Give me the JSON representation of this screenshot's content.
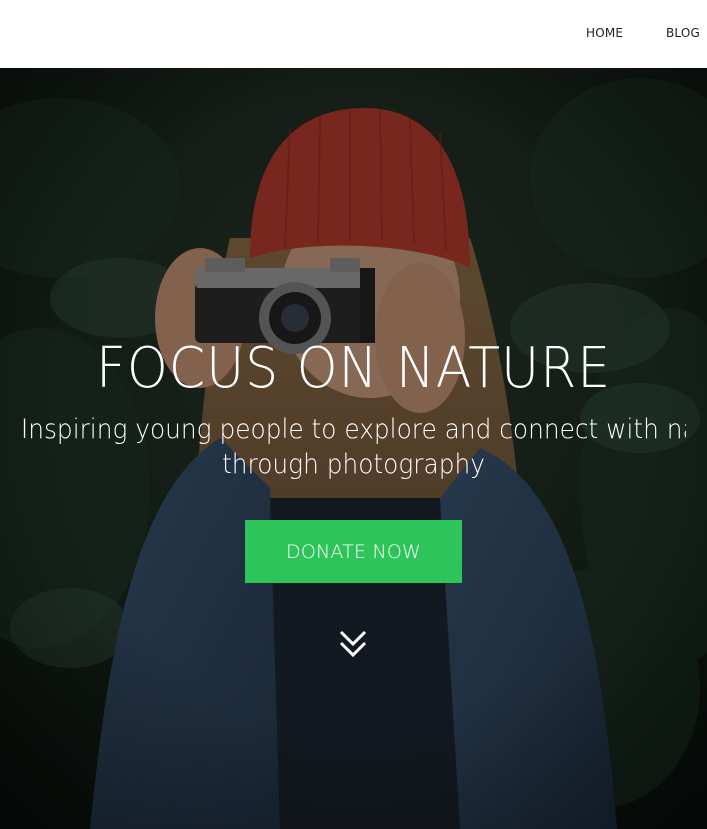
{
  "header": {
    "nav": {
      "home_label": "HOME",
      "blog_label": "BLOG"
    }
  },
  "hero": {
    "title": "FOCUS ON NATURE",
    "subtitle_line1": "Inspiring young people to explore and connect with nature",
    "subtitle_line2": "through photography",
    "donate_label": "DONATE NOW",
    "scroll_icon": "double-chevron-down-icon",
    "background_image": "woman-with-camera-photo"
  },
  "colors": {
    "accent": "#2dc55a",
    "header_bg": "#ffffff",
    "nav_text": "#1f1f1f",
    "hero_text": "#ffffff"
  }
}
